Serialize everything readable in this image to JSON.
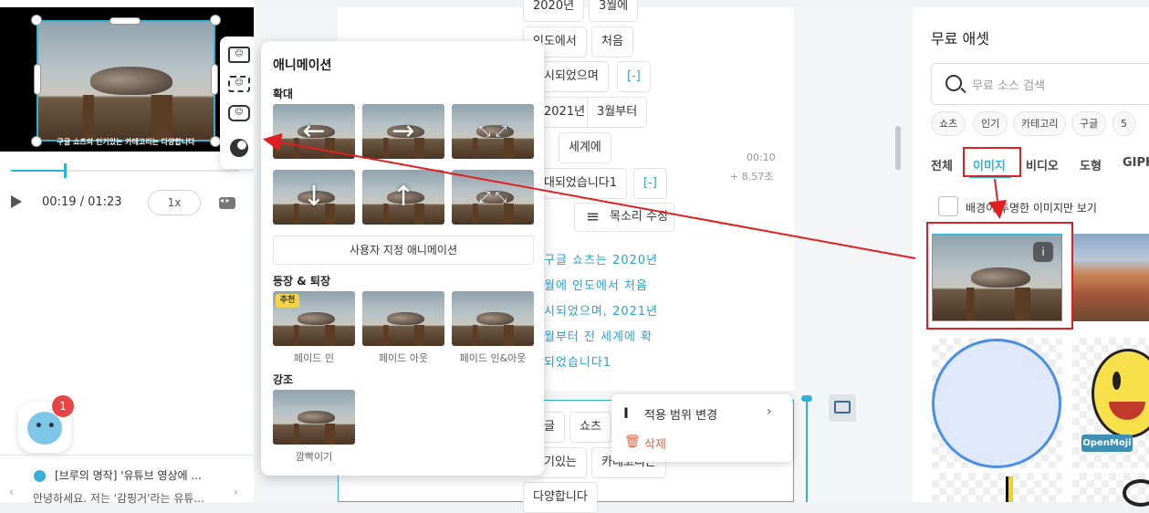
{
  "preview": {
    "caption": "구글 쇼츠의 인기있는 카테고리는 다양합니다",
    "time": "00:19 / 01:23",
    "speed": "1x",
    "chat_badge": "1",
    "news_title": "[브루의 명작] '유튜브 영상에 ...",
    "news_sub": "안녕하세요. 저는 '감핑거'라는 유튜..."
  },
  "toolbar": {
    "icons": [
      "emoji-frame-icon",
      "emoji-face-icon",
      "emoji-face-small-icon",
      "animation-icon"
    ]
  },
  "script": {
    "words_top": [
      "2020년",
      "3월에"
    ],
    "row1": [
      "인도에서",
      "처음"
    ],
    "row2a": "시되었으며",
    "row2b": "[-]",
    "row3": [
      "2021년",
      "3월부터"
    ],
    "row4": "세계에",
    "row5a": "대되었습니다1",
    "row5b": "[-]",
    "timestamp": "00:10",
    "duration": "+ 8.57초",
    "voice_edit": "목소리 수정",
    "lines": [
      "구글 쇼츠는 2020년",
      "월에 인도에서 처음",
      "시되었으며, 2021년",
      "월부터 전 세계에 확",
      "되었습니다1"
    ],
    "card2": [
      "글",
      "쇼츠",
      "기있는",
      "카테고리는",
      "다양합니다"
    ]
  },
  "context_menu": {
    "scope": "적용 범위 변경",
    "delete": "삭제"
  },
  "animation_panel": {
    "title": "애니메이션",
    "section_zoom": "확대",
    "custom": "사용자 지정 애니메이션",
    "section_enter": "등장 & 퇴장",
    "recommended": "추천",
    "enter_items": [
      "페이드 인",
      "페이드 아웃",
      "페이드 인&아웃"
    ],
    "section_emphasis": "강조",
    "emphasis_items": [
      "깜빡이기"
    ]
  },
  "assets": {
    "title": "무료 애셋",
    "search_placeholder": "무료 소스 검색",
    "chips": [
      "쇼츠",
      "인기",
      "카테고리",
      "구글",
      "5"
    ],
    "tabs": [
      "전체",
      "이미지",
      "비디오",
      "도형",
      "GIPHY"
    ],
    "transparent_only": "배경이 투명한 이미지만 보기",
    "openmoji": "OpenMoji"
  },
  "colors": {
    "accent": "#2ab4d6",
    "annotation": "#e02020"
  }
}
